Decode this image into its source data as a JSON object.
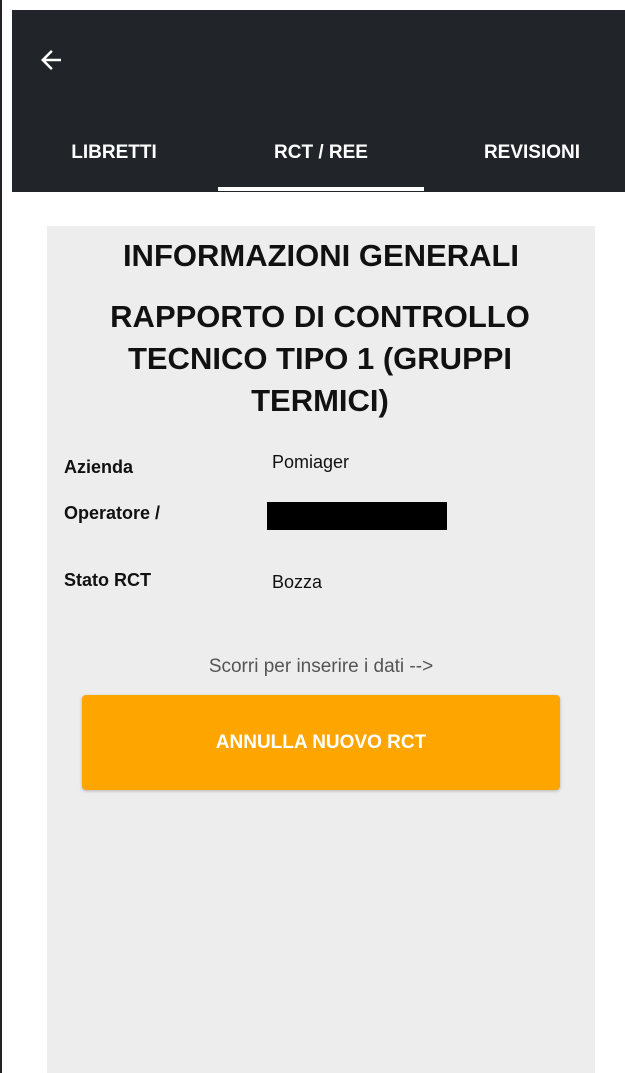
{
  "header": {
    "back_icon": "arrow-left-icon",
    "tabs": [
      {
        "label": "LIBRETTI"
      },
      {
        "label": "RCT / REE"
      },
      {
        "label": "REVISIONI"
      }
    ],
    "active_tab": "RCT / REE"
  },
  "main": {
    "title": "INFORMAZIONI GENERALI",
    "subtitle": "RAPPORTO DI CONTROLLO TECNICO TIPO 1 (GRUPPI TERMICI)",
    "fields": [
      {
        "label": "Azienda",
        "value": "Pomiager"
      },
      {
        "label": "Operatore /",
        "value": ""
      },
      {
        "label": "Stato RCT",
        "value": "Bozza"
      }
    ],
    "hint": "Scorri per inserire i dati -->",
    "cancel_button": "ANNULLA NUOVO RCT"
  },
  "colors": {
    "header_bg": "#212529",
    "accent": "#ffa500",
    "card_bg": "#ededed"
  }
}
